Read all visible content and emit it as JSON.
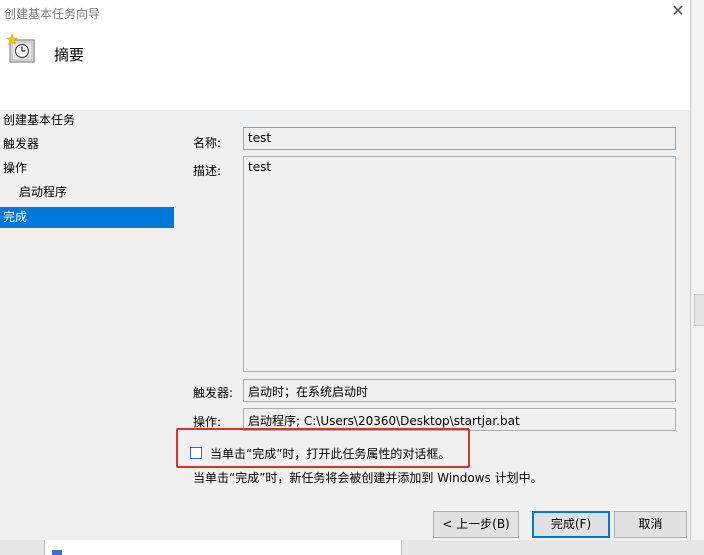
{
  "window": {
    "title": "创建基本任务向导"
  },
  "header": {
    "title": "摘要",
    "icon": "clock-icon"
  },
  "nav": {
    "items": [
      {
        "label": "创建基本任务",
        "selected": false,
        "indent": false
      },
      {
        "label": "触发器",
        "selected": false,
        "indent": false
      },
      {
        "label": "操作",
        "selected": false,
        "indent": false
      },
      {
        "label": "启动程序",
        "selected": false,
        "indent": true
      },
      {
        "label": "完成",
        "selected": true,
        "indent": false
      }
    ]
  },
  "form": {
    "name_label": "名称:",
    "name_value": "test",
    "desc_label": "描述:",
    "desc_value": "test",
    "trigger_label": "触发器:",
    "trigger_value": "启动时；在系统启动时",
    "action_label": "操作:",
    "action_value": "启动程序; C:\\Users\\20360\\Desktop\\startjar.bat"
  },
  "checkbox": {
    "label": "当单击“完成”时，打开此任务属性的对话框。",
    "checked": false
  },
  "info": {
    "text": "当单击“完成”时，新任务将会被创建并添加到 Windows 计划中。"
  },
  "buttons": {
    "back": "< 上一步(B)",
    "finish": "完成(F)",
    "cancel": "取消"
  },
  "colors": {
    "accent": "#0078d7",
    "highlight_border": "#e0302a"
  }
}
